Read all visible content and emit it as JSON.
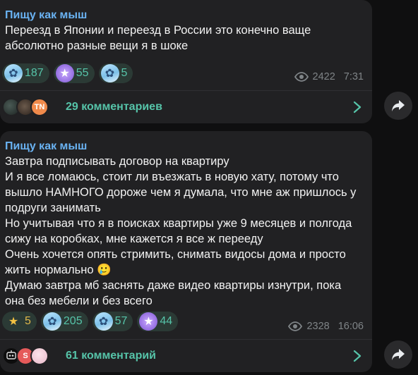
{
  "posts": [
    {
      "author": "Пищу как мыш",
      "text": "Переезд в Японии и переезд в России это конечно ваще\nабсолютно разные вещи я в шоке",
      "reactions": [
        {
          "icon": "anime-face",
          "count": "187"
        },
        {
          "icon": "star",
          "count": "55"
        },
        {
          "icon": "anime-face",
          "count": "5"
        }
      ],
      "views": "2422",
      "time": "7:31",
      "comments_label": "29 комментариев",
      "comment_avatars": [
        {
          "icon": "avatar-photo",
          "text": ""
        },
        {
          "icon": "avatar-photo",
          "text": ""
        },
        {
          "icon": "avatar-initials",
          "text": "TN"
        }
      ]
    },
    {
      "author": "Пищу как мыш",
      "text": "Завтра подписывать договор на квартиру\nИ я все ломаюсь, стоит ли въезжать в новую хату, потому что\nвышло НАМНОГО дороже чем я думала, что мне аж пришлось у\nподруги занимать\nНо учитывая что я в поисках квартиры уже 9 месяцев и полгода\nсижу на коробках, мне кажется я все ж перееду\nОчень хочется опять стримить, снимать видосы дома и просто\nжить нормально 🥲\nДумаю завтра мб заснять даже видео квартиры изнутри, пока\nона без мебели и без всего",
      "reactions": [
        {
          "icon": "star",
          "count": "5"
        },
        {
          "icon": "anime-face",
          "count": "205"
        },
        {
          "icon": "anime-face",
          "count": "57"
        },
        {
          "icon": "star",
          "count": "44"
        }
      ],
      "views": "2328",
      "time": "16:06",
      "comments_label": "61 комментарий",
      "comment_avatars": [
        {
          "icon": "avatar-photo",
          "text": ""
        },
        {
          "icon": "avatar-initials",
          "text": "S"
        },
        {
          "icon": "avatar-photo",
          "text": ""
        }
      ]
    }
  ],
  "colors": {
    "author": "#6ab3f3",
    "accent": "#56c4a9",
    "bubble": "#212123",
    "background": "#0f0f10"
  }
}
